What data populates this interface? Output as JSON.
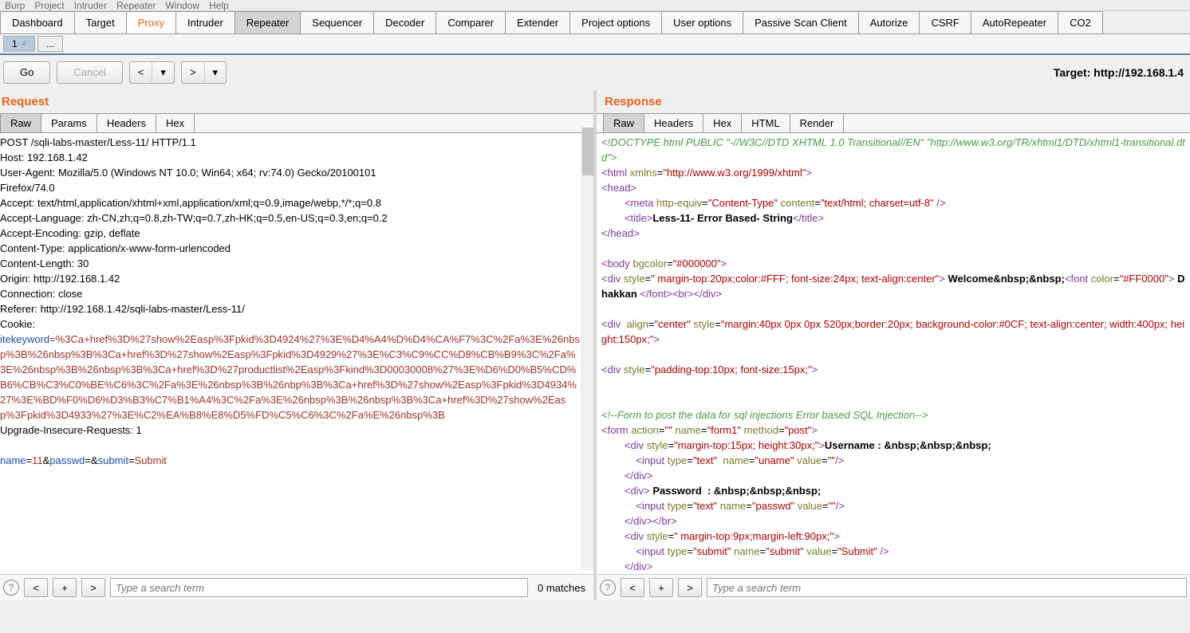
{
  "menubar": [
    "Burp",
    "Project",
    "Intruder",
    "Repeater",
    "Window",
    "Help"
  ],
  "main_tabs": [
    "Dashboard",
    "Target",
    "Proxy",
    "Intruder",
    "Repeater",
    "Sequencer",
    "Decoder",
    "Comparer",
    "Extender",
    "Project options",
    "User options",
    "Passive Scan Client",
    "Autorize",
    "CSRF",
    "AutoRepeater",
    "CO2"
  ],
  "main_orange": "Proxy",
  "main_grey": "Repeater",
  "subtabs": {
    "num": "1",
    "dots": "..."
  },
  "actions": {
    "go": "Go",
    "cancel": "Cancel",
    "back": "<",
    "back2": "▾",
    "fwd": ">",
    "fwd2": "▾"
  },
  "target": "Target: http://192.168.1.4",
  "request": {
    "title": "Request",
    "tabs": [
      "Raw",
      "Params",
      "Headers",
      "Hex"
    ],
    "headers": [
      "POST /sqli-labs-master/Less-11/ HTTP/1.1",
      "Host: 192.168.1.42",
      "User-Agent: Mozilla/5.0 (Windows NT 10.0; Win64; x64; rv:74.0) Gecko/20100101",
      "Firefox/74.0",
      "Accept: text/html,application/xhtml+xml,application/xml;q=0.9,image/webp,*/*;q=0.8",
      "Accept-Language: zh-CN,zh;q=0.8,zh-TW;q=0.7,zh-HK;q=0.5,en-US;q=0.3,en;q=0.2",
      "Accept-Encoding: gzip, deflate",
      "Content-Type: application/x-www-form-urlencoded",
      "Content-Length: 30",
      "Origin: http://192.168.1.42",
      "Connection: close",
      "Referer: http://192.168.1.42/sqli-labs-master/Less-11/",
      "Cookie:"
    ],
    "cookie_key": "itekeyword",
    "cookie_val": "=%3Ca+href%3D%27show%2Easp%3Fpkid%3D4924%27%3E%D4%A4%D%D4%CA%F7%3C%2Fa%3E%26nbsp%3B%26nbsp%3B%3Ca+href%3D%27show%2Easp%3Fpkid%3D4929%27%3E%C3%C9%CC%D8%CB%B9%3C%2Fa%3E%26nbsp%3B%26nbsp%3B%3Ca+href%3D%27productlist%2Easp%3Fkind%3D00030008%27%3E%D6%D0%B5%CD%B6%CB%C3%C0%BE%C6%3C%2Fa%3E%26nbsp%3B%26nbp%3B%3Ca+href%3D%27show%2Easp%3Fpkid%3D4934%27%3E%BD%F0%D6%D3%B3%C7%B1%A4%3C%2Fa%3E%26nbsp%3B%26nbsp%3B%3Ca+href%3D%27show%2Easp%3Fpkid%3D4933%27%3E%C2%EA%B8%E8%D5%FD%C5%C6%3C%2Fa%E%26nbsp%3B",
    "after_cookie": "Upgrade-Insecure-Requests: 1",
    "body": {
      "k1": "name",
      "v1": "11",
      "amp": "&",
      "k2": "passwd",
      "v2": "",
      "amp2": "&",
      "k3": "submit",
      "v3": "Submit"
    }
  },
  "response": {
    "title": "Response",
    "tabs": [
      "Raw",
      "Headers",
      "Hex",
      "HTML",
      "Render"
    ]
  },
  "search": {
    "placeholder": "Type a search term",
    "matches": "0 matches"
  }
}
